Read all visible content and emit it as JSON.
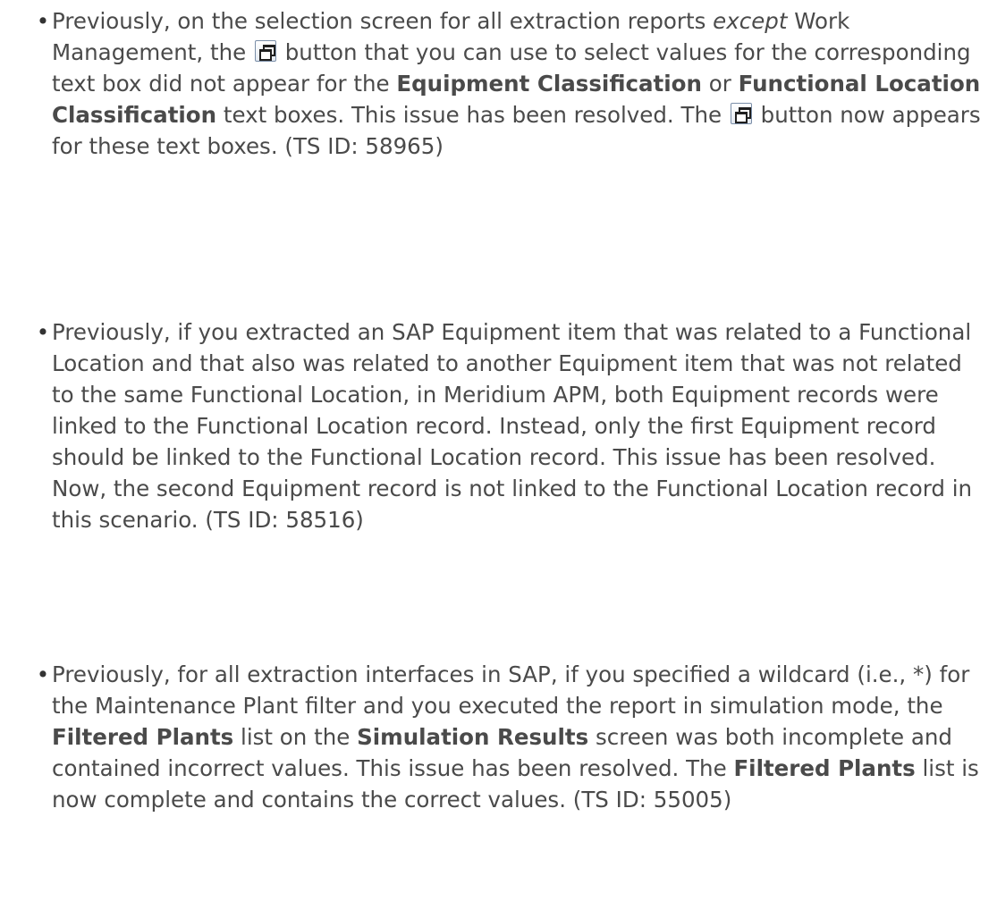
{
  "items": [
    {
      "segments": [
        {
          "t": "Previously, on the selection screen for all extraction reports "
        },
        {
          "t": "except",
          "s": "i"
        },
        {
          "t": " Work Management, the "
        },
        {
          "icon": "select-values-button-icon"
        },
        {
          "t": " button that you can use to select values for the corresponding text box did not appear for the "
        },
        {
          "t": "Equipment Classification",
          "s": "b"
        },
        {
          "t": " or "
        },
        {
          "t": "Functional Location Classification",
          "s": "b"
        },
        {
          "t": " text boxes. This issue has been resolved. The "
        },
        {
          "icon": "select-values-button-icon"
        },
        {
          "t": " button now appears for these text boxes. (TS ID: 58965)"
        }
      ]
    },
    {
      "segments": [
        {
          "t": "Previously, if you extracted an SAP Equipment item that was related to a Functional Location and that also was related to another Equipment item that was not related to the same Functional Location, in Meridium APM, both Equipment records were linked to the Functional Location record. Instead, only the first Equipment record should be linked to the Functional Location record. This issue has been resolved. Now, the second Equipment record is not linked to the Functional Location record in this scenario. (TS ID: 58516)"
        }
      ]
    },
    {
      "segments": [
        {
          "t": "Previously, for all extraction interfaces in SAP, if you specified a wildcard (i.e., *) for the Maintenance Plant filter and you executed the report in simulation mode, the "
        },
        {
          "t": "Filtered Plants",
          "s": "b"
        },
        {
          "t": " list on the "
        },
        {
          "t": "Simulation Results",
          "s": "b"
        },
        {
          "t": " screen was both incomplete and contained incorrect values. This issue has been resolved. The "
        },
        {
          "t": "Filtered Plants",
          "s": "b"
        },
        {
          "t": " list is now complete and contains the correct values. (TS ID: 55005)"
        }
      ]
    }
  ],
  "bullet_glyph": "•"
}
